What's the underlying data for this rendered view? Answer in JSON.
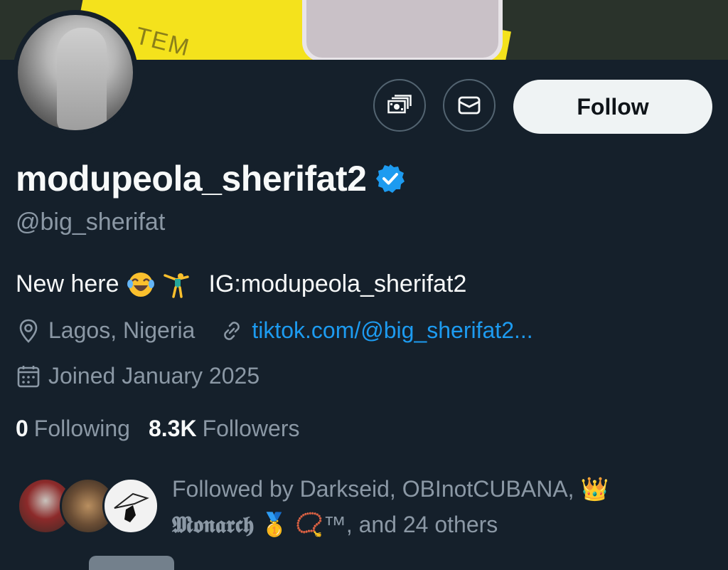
{
  "banner": {
    "stamp_text": "TEM"
  },
  "actions": {
    "follow_label": "Follow",
    "tip_icon": "money-icon",
    "message_icon": "envelope-icon"
  },
  "profile": {
    "display_name": "modupeola_sherifat2",
    "verified": true,
    "handle": "@big_sherifat",
    "bio_prefix": "New here",
    "bio_emojis": [
      "face-with-tears-of-joy",
      "person-cartwheeling"
    ],
    "bio_suffix": "IG:modupeola_sherifat2",
    "location": "Lagos, Nigeria",
    "website": "tiktok.com/@big_sherifat2...",
    "joined": "Joined January 2025"
  },
  "stats": {
    "following_count": "0",
    "following_label": "Following",
    "followers_count": "8.3K",
    "followers_label": "Followers"
  },
  "followed_by": {
    "line1": "Followed by Darkseid, OBInotCUBANA, 👑",
    "monarch": "𝕸𝖔𝖓𝖆𝖗𝖈𝖍",
    "line2_rest": "🥇 📿™, and 24 others"
  },
  "colors": {
    "background": "#15202b",
    "primary_text": "#f7f9f9",
    "secondary_text": "#8b98a5",
    "link": "#1d9bf0",
    "follow_button_bg": "#eff3f4"
  }
}
